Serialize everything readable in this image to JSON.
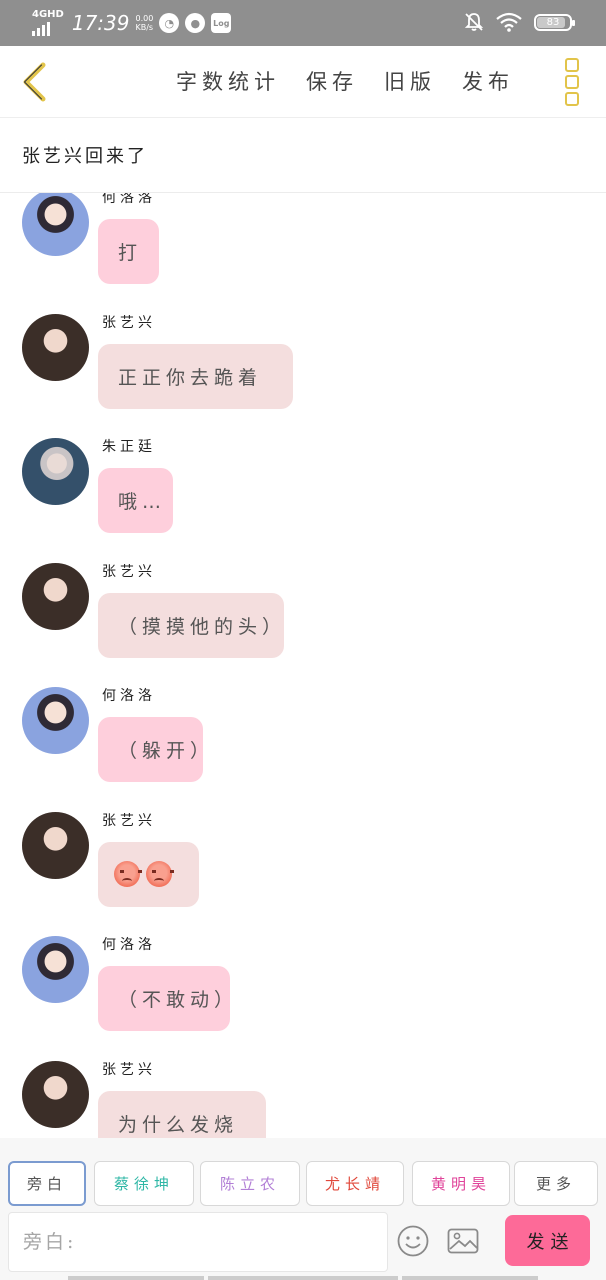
{
  "status_bar": {
    "network": "4GHD",
    "time": "17:39",
    "speed_value": "0.00",
    "speed_unit": "KB/s",
    "log_label": "Log",
    "battery": "83"
  },
  "header": {
    "actions": [
      "字数统计",
      "保存",
      "旧版",
      "发布"
    ]
  },
  "story_title": "张艺兴回来了",
  "messages": [
    {
      "speaker": "何洛洛",
      "text": "打",
      "avatar": "he",
      "bubble": "pink"
    },
    {
      "speaker": "张艺兴",
      "text": "正正你去跪着",
      "avatar": "zheng",
      "bubble": "grey"
    },
    {
      "speaker": "朱正廷",
      "text": "哦…",
      "avatar": "zhu",
      "bubble": "pink"
    },
    {
      "speaker": "张艺兴",
      "text": "（摸摸他的头）",
      "avatar": "zheng",
      "bubble": "grey"
    },
    {
      "speaker": "何洛洛",
      "text": "（躲开）",
      "avatar": "he",
      "bubble": "pink"
    },
    {
      "speaker": "张艺兴",
      "text": "",
      "emoji": [
        "angry-face-icon",
        "angry-face-icon"
      ],
      "avatar": "zheng",
      "bubble": "grey"
    },
    {
      "speaker": "何洛洛",
      "text": "（不敢动）",
      "avatar": "he",
      "bubble": "pink"
    },
    {
      "speaker": "张艺兴",
      "text": "为什么发烧",
      "avatar": "zheng",
      "bubble": "grey"
    }
  ],
  "roles": [
    {
      "label": "旁白",
      "color": "#555555",
      "active": true
    },
    {
      "label": "蔡徐坤",
      "color": "#2fb7a6",
      "active": false
    },
    {
      "label": "陈立农",
      "color": "#b27fd6",
      "active": false
    },
    {
      "label": "尤长靖",
      "color": "#e0483b",
      "active": false
    },
    {
      "label": "黄明昊",
      "color": "#e0449a",
      "active": false
    },
    {
      "label": "更多",
      "color": "#555555",
      "active": false
    }
  ],
  "input": {
    "placeholder": "旁白:",
    "send_label": "发送"
  },
  "colors": {
    "accent_yellow": "#e2c44a",
    "send_pink": "#fd6a98",
    "bubble_pink": "#fecfdc",
    "bubble_grey": "#f4dede"
  }
}
